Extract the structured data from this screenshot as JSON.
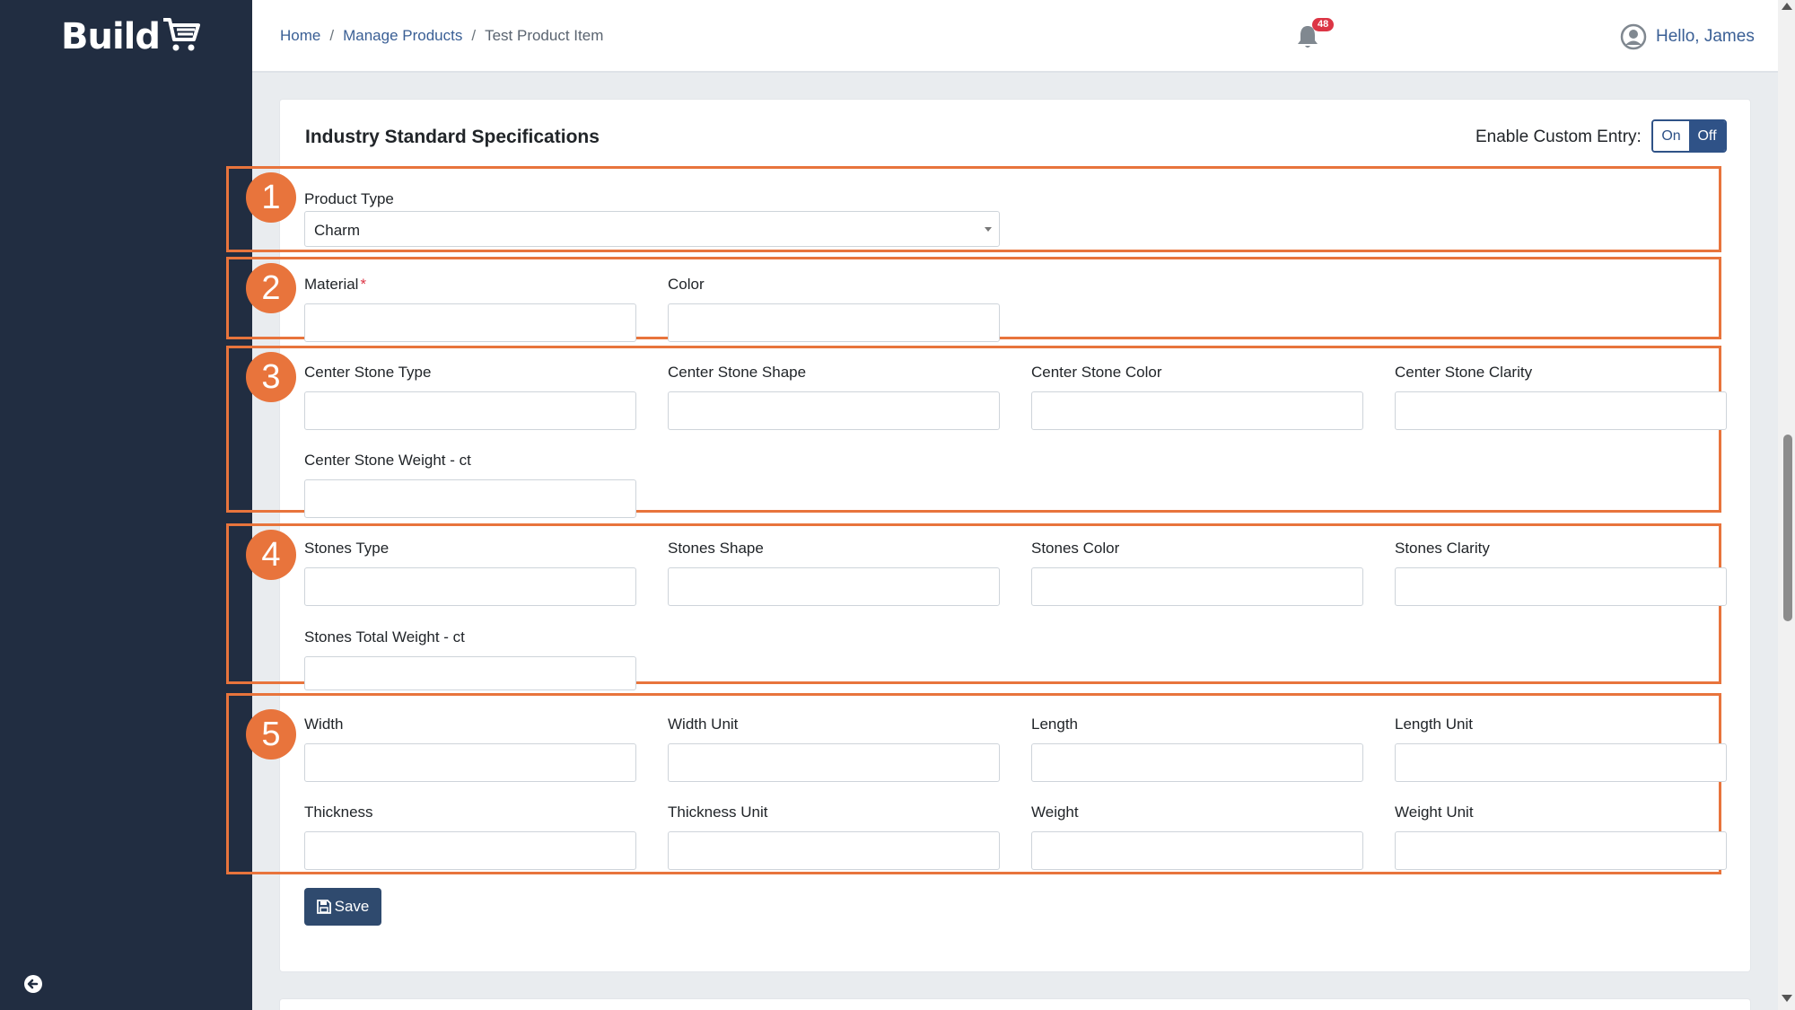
{
  "brand": {
    "name": "Build"
  },
  "breadcrumb": {
    "home": "Home",
    "manage": "Manage Products",
    "current": "Test Product Item",
    "sep": "/"
  },
  "header": {
    "notification_count": "48",
    "greeting": "Hello, James"
  },
  "card": {
    "title": "Industry Standard Specifications",
    "custom_entry_label": "Enable Custom Entry:",
    "toggle_on": "On",
    "toggle_off": "Off",
    "toggle_state": "Off"
  },
  "sections": [
    {
      "number": "1"
    },
    {
      "number": "2"
    },
    {
      "number": "3"
    },
    {
      "number": "4"
    },
    {
      "number": "5"
    }
  ],
  "form": {
    "product_type": {
      "label": "Product Type",
      "value": "Charm"
    },
    "material": {
      "label": "Material",
      "required": "*"
    },
    "color": {
      "label": "Color"
    },
    "center_stone_type": {
      "label": "Center Stone Type"
    },
    "center_stone_shape": {
      "label": "Center Stone Shape"
    },
    "center_stone_color": {
      "label": "Center Stone Color"
    },
    "center_stone_clarity": {
      "label": "Center Stone Clarity"
    },
    "center_stone_weight": {
      "label": "Center Stone Weight - ct"
    },
    "stones_type": {
      "label": "Stones Type"
    },
    "stones_shape": {
      "label": "Stones Shape"
    },
    "stones_color": {
      "label": "Stones Color"
    },
    "stones_clarity": {
      "label": "Stones Clarity"
    },
    "stones_total_weight": {
      "label": "Stones Total Weight - ct"
    },
    "width": {
      "label": "Width"
    },
    "width_unit": {
      "label": "Width Unit"
    },
    "length": {
      "label": "Length"
    },
    "length_unit": {
      "label": "Length Unit"
    },
    "thickness": {
      "label": "Thickness"
    },
    "thickness_unit": {
      "label": "Thickness Unit"
    },
    "weight": {
      "label": "Weight"
    },
    "weight_unit": {
      "label": "Weight Unit"
    }
  },
  "actions": {
    "save_label": "Save"
  },
  "colors": {
    "sidebar": "#212d41",
    "accent": "#2f5287",
    "annotation": "#e8743c",
    "badge": "#dc3545"
  }
}
